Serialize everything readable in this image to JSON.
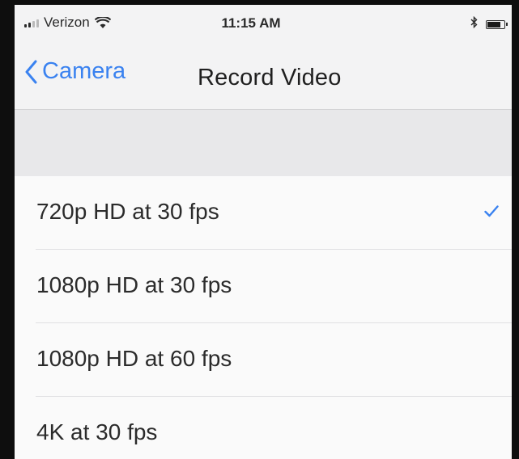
{
  "status_bar": {
    "carrier": "Verizon",
    "time": "11:15 AM",
    "icons": [
      "signal-icon",
      "wifi-icon",
      "bluetooth-icon",
      "battery-icon"
    ]
  },
  "nav": {
    "back_label": "Camera",
    "title": "Record Video"
  },
  "options": [
    {
      "label": "720p HD at 30 fps",
      "selected": true
    },
    {
      "label": "1080p HD at 30 fps",
      "selected": false
    },
    {
      "label": "1080p HD at 60 fps",
      "selected": false
    },
    {
      "label": "4K at 30 fps",
      "selected": false
    }
  ],
  "colors": {
    "accent": "#3a82f0",
    "background": "#efeff1",
    "text": "#2b2b2b"
  }
}
